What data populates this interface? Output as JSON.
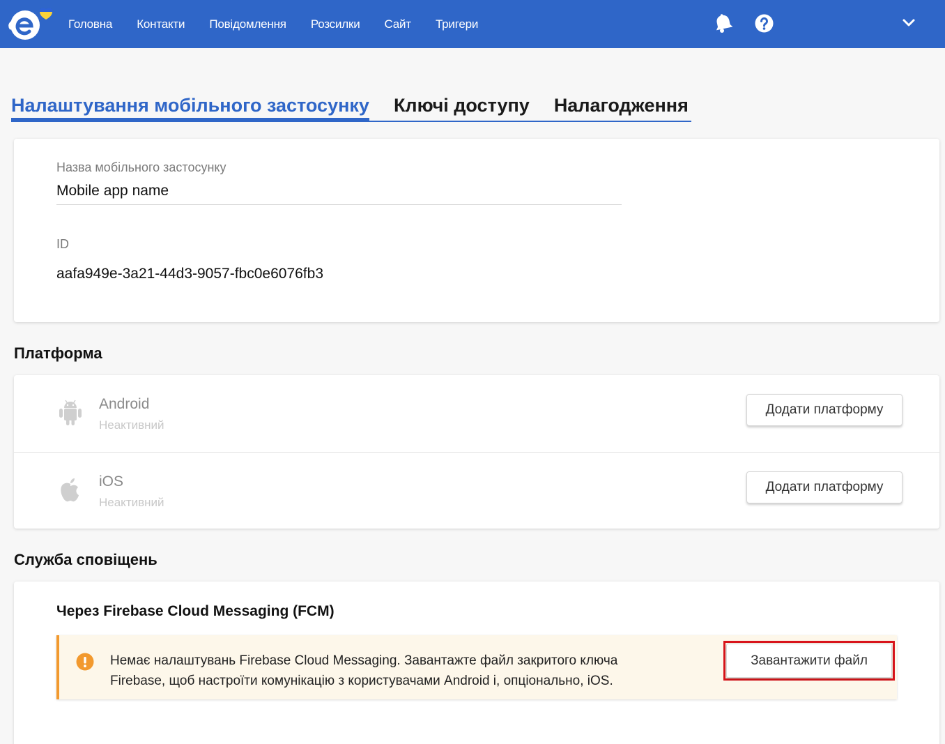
{
  "nav": {
    "items": [
      "Головна",
      "Контакти",
      "Повідомлення",
      "Розсилки",
      "Сайт",
      "Тригери"
    ]
  },
  "colors": {
    "primary": "#2f66c8",
    "warning": "#f2992e",
    "highlight": "#d8141b",
    "flag_blue": "#2e63d6",
    "flag_yellow": "#f9d33a"
  },
  "icons": [
    "logo-icon",
    "bell-icon",
    "help-icon",
    "chevron-down-icon",
    "android-icon",
    "apple-icon",
    "warning-icon"
  ],
  "tabs": [
    {
      "label": "Налаштування мобільного застосунку",
      "active": true
    },
    {
      "label": "Ключі доступу",
      "active": false
    },
    {
      "label": "Налагодження",
      "active": false
    }
  ],
  "app": {
    "name_label": "Назва мобільного застосунку",
    "name_value": "Mobile app name",
    "id_label": "ID",
    "id_value": "aafa949e-3a21-44d3-9057-fbc0e6076fb3"
  },
  "platform": {
    "title": "Платформа",
    "items": [
      {
        "name": "Android",
        "status": "Неактивний",
        "button": "Додати платформу"
      },
      {
        "name": "iOS",
        "status": "Неактивний",
        "button": "Додати платформу"
      }
    ]
  },
  "notifications": {
    "title": "Служба сповіщень",
    "fcm_title": "Через Firebase Cloud Messaging (FCM)",
    "alert_line1": "Немає налаштувань Firebase Cloud Messaging. Завантажте файл закритого ключа",
    "alert_line2": "Firebase, щоб настроїти комунікацію з користувачами Android і, опціонально, iOS.",
    "upload_button": "Завантажити файл"
  }
}
